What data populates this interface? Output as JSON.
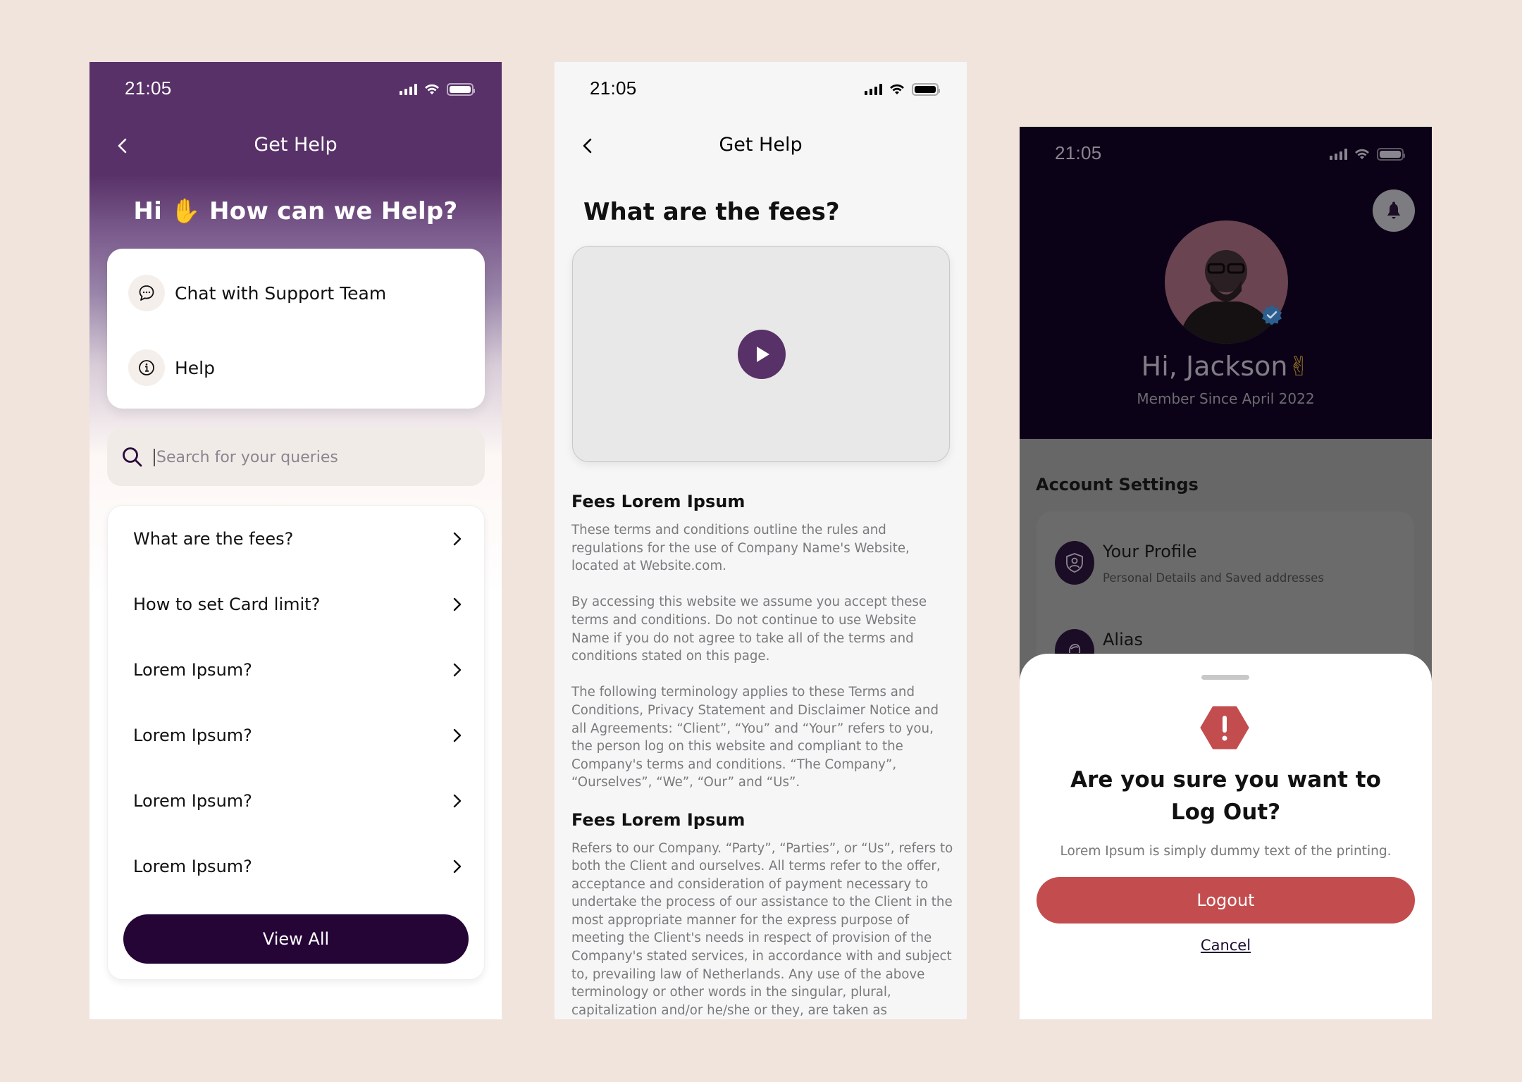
{
  "colors": {
    "background": "#f0e4dd",
    "brand_purple": "#583168",
    "dark_purple": "#250436",
    "danger_red": "#c34d4e",
    "verified_blue": "#2b7fd4"
  },
  "screens": {
    "help_home": {
      "status_bar": {
        "time": "21:05"
      },
      "nav": {
        "title": "Get Help",
        "back_icon": "chevron-left-icon"
      },
      "greeting": {
        "prefix": "Hi",
        "emoji": "✋",
        "text": "How can we Help?"
      },
      "actions": [
        {
          "label": "Chat with Support Team",
          "icon": "chat-bubble-icon"
        },
        {
          "label": "Help",
          "icon": "info-icon"
        }
      ],
      "search": {
        "placeholder": "Search for your queries",
        "value": "",
        "icon": "search-icon"
      },
      "faqs": [
        {
          "question": "What are the fees?"
        },
        {
          "question": "How to set Card limit?"
        },
        {
          "question": "Lorem Ipsum?"
        },
        {
          "question": "Lorem Ipsum?"
        },
        {
          "question": "Lorem Ipsum?"
        },
        {
          "question": "Lorem Ipsum?"
        }
      ],
      "view_all_label": "View All"
    },
    "article": {
      "status_bar": {
        "time": "21:05"
      },
      "nav": {
        "title": "Get Help",
        "back_icon": "chevron-left-icon"
      },
      "title": "What are the fees?",
      "video": {
        "play_icon": "play-icon"
      },
      "sections": [
        {
          "heading": "Fees Lorem Ipsum",
          "paragraphs": [
            "These terms and conditions outline the rules and regulations for the use of Company Name's Website, located at Website.com.",
            "By accessing this website we assume you accept these terms and conditions. Do not continue to use Website Name if you do not agree to take all of the terms and conditions stated on this page.",
            "The following terminology applies to these Terms and Conditions, Privacy Statement and Disclaimer Notice and all Agreements: “Client”, “You” and “Your” refers to you, the person log on this website and compliant to the Company's terms and conditions. “The Company”, “Ourselves”, “We”, “Our” and “Us”."
          ]
        },
        {
          "heading": "Fees Lorem Ipsum",
          "paragraphs": [
            "Refers to our Company. “Party”, “Parties”, or “Us”, refers to both the Client and ourselves. All terms refer to the offer, acceptance and consideration of payment necessary to undertake the process of our assistance to the Client in the most appropriate manner for the express purpose of meeting the Client's needs in respect of provision of the Company's stated services, in accordance with and subject to, prevailing law of Netherlands. Any use of the above terminology or other words in the singular, plural, capitalization and/or he/she or they, are taken as interchangeable and therefore as"
          ]
        }
      ]
    },
    "profile_logout": {
      "status_bar": {
        "time": "21:05"
      },
      "greeting": "Hi, Jackson",
      "greeting_emoji": "✌",
      "member_since": "Member Since April 2022",
      "notification_icon": "bell-icon",
      "verified_badge": "verified-badge-icon",
      "account_settings": {
        "title": "Account Settings",
        "items": [
          {
            "title": "Your Profile",
            "subtitle": "Personal Details and Saved addresses",
            "icon": "shield-user-icon"
          },
          {
            "title": "Alias",
            "subtitle": "",
            "icon": "user-alias-icon"
          }
        ]
      },
      "logout_sheet": {
        "icon": "warning-octagon-icon",
        "title_line1": "Are you sure you want to",
        "title_line2": "Log Out?",
        "subtitle": "Lorem Ipsum is simply dummy text of the printing.",
        "confirm_label": "Logout",
        "cancel_label": "Cancel"
      }
    }
  }
}
